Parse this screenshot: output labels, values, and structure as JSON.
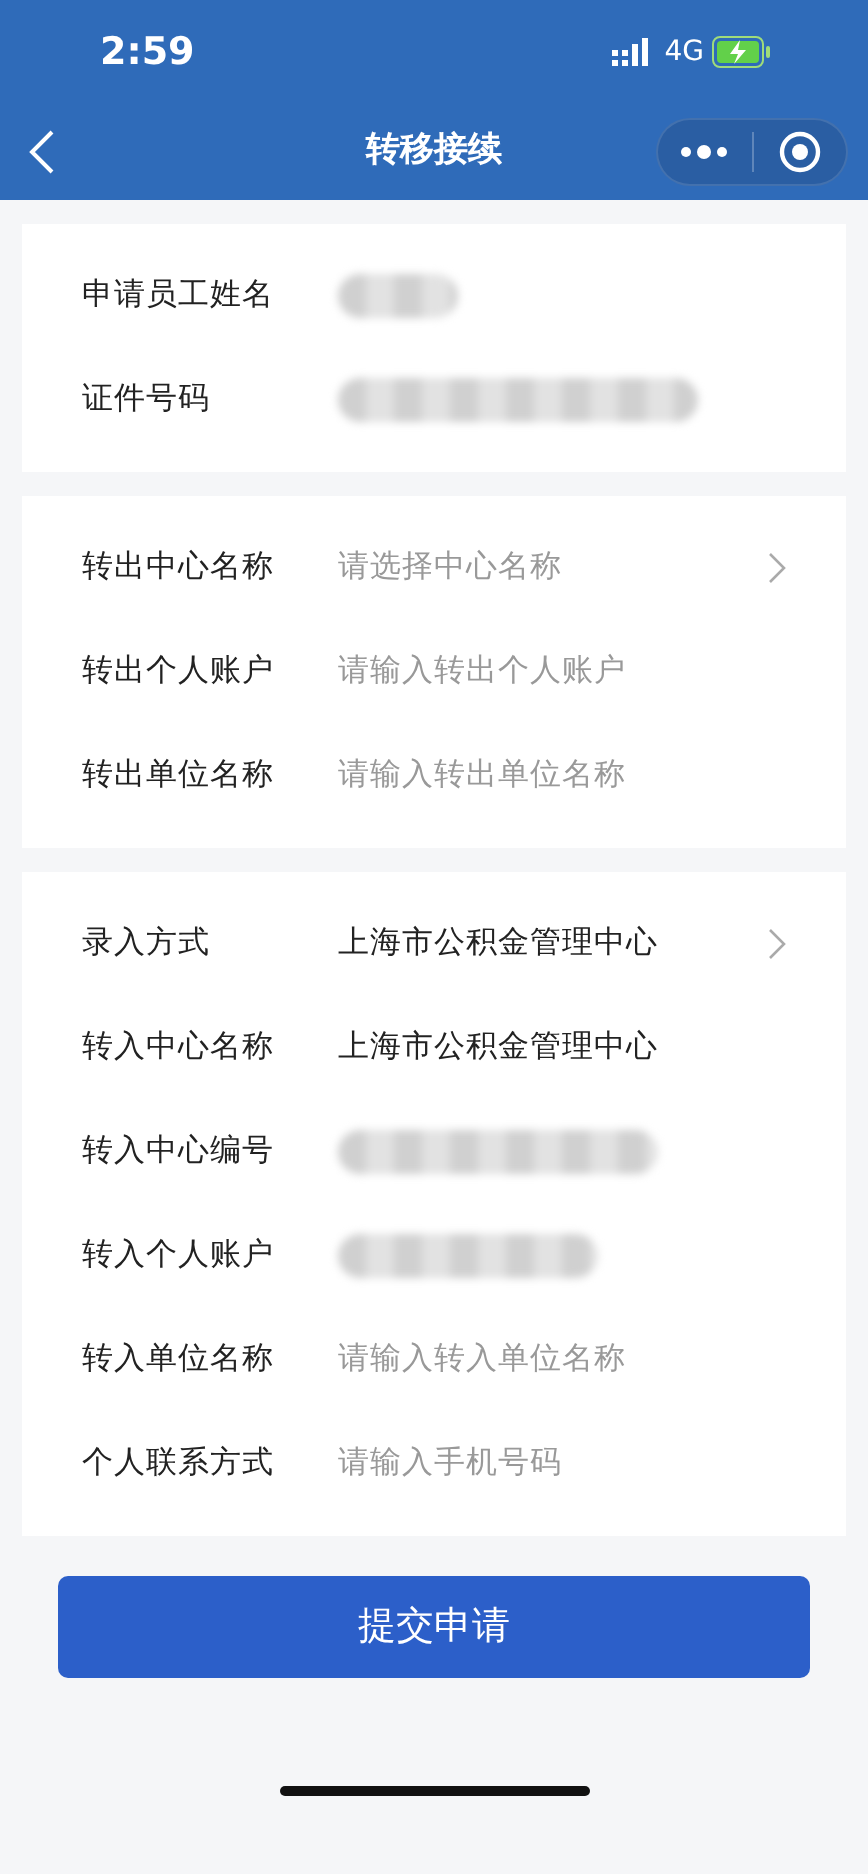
{
  "status_bar": {
    "time": "2:59",
    "network": "4G"
  },
  "nav": {
    "title": "转移接续"
  },
  "sections": [
    {
      "rows": [
        {
          "label": "申请员工姓名",
          "kind": "redacted"
        },
        {
          "label": "证件号码",
          "kind": "redacted"
        }
      ]
    },
    {
      "rows": [
        {
          "label": "转出中心名称",
          "kind": "select",
          "placeholder": "请选择中心名称"
        },
        {
          "label": "转出个人账户",
          "kind": "input",
          "placeholder": "请输入转出个人账户"
        },
        {
          "label": "转出单位名称",
          "kind": "input",
          "placeholder": "请输入转出单位名称"
        }
      ]
    },
    {
      "rows": [
        {
          "label": "录入方式",
          "kind": "select",
          "value": "上海市公积金管理中心"
        },
        {
          "label": "转入中心名称",
          "kind": "text",
          "value": "上海市公积金管理中心"
        },
        {
          "label": "转入中心编号",
          "kind": "redacted"
        },
        {
          "label": "转入个人账户",
          "kind": "redacted"
        },
        {
          "label": "转入单位名称",
          "kind": "input",
          "placeholder": "请输入转入单位名称"
        },
        {
          "label": "个人联系方式",
          "kind": "input",
          "placeholder": "请输入手机号码"
        }
      ]
    }
  ],
  "submit": {
    "label": "提交申请"
  }
}
